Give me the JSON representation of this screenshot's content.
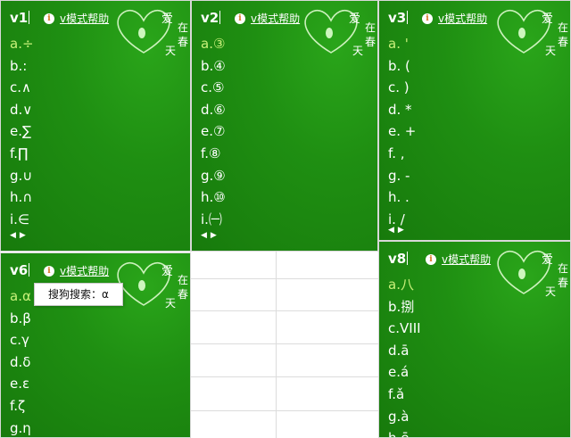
{
  "help_label": "v模式帮助",
  "info_glyph": "i",
  "pager": {
    "prev": "◀",
    "next": "▶"
  },
  "deco_text": {
    "ai": "爱",
    "zai": "在",
    "chun": "春",
    "tian": "天"
  },
  "panels": [
    {
      "code": "v1",
      "candidates": [
        "a.÷",
        "b.:",
        "c.∧",
        "d.∨",
        "e.∑",
        "f.∏",
        "g.∪",
        "h.∩",
        "i.∈"
      ]
    },
    {
      "code": "v2",
      "candidates": [
        "a.③",
        "b.④",
        "c.⑤",
        "d.⑥",
        "e.⑦",
        "f.⑧",
        "g.⑨",
        "h.⑩",
        "i.㈠"
      ]
    },
    {
      "code": "v3",
      "candidates": [
        "a. '",
        "b. (",
        "c. )",
        "d. *",
        "e. +",
        "f. ,",
        "g. -",
        "h. .",
        "i. /"
      ]
    },
    {
      "code": "v6",
      "candidates": [
        "a.α",
        "b.β",
        "c.γ",
        "d.δ",
        "e.ε",
        "f.ζ",
        "g.η"
      ]
    },
    {
      "code": "v8",
      "candidates": [
        "a.八",
        "b.捌",
        "c.VIII",
        "d.ā",
        "e.á",
        "f.ǎ",
        "g.à",
        "h.ē"
      ]
    }
  ],
  "sogou_popup": "搜狗搜索：α",
  "colors": {
    "panel_green": "#1f8f12",
    "highlight": "#c8f07a",
    "info_orange": "#d6731a"
  }
}
